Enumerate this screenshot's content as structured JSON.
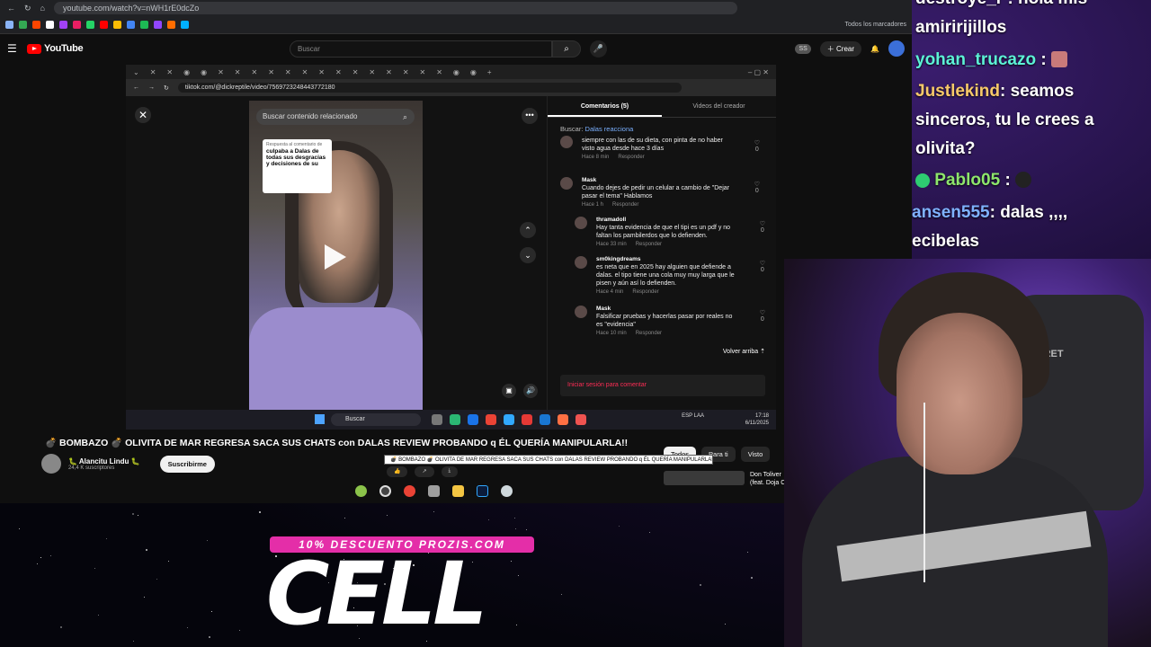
{
  "browser": {
    "url": "youtube.com/watch?v=nWH1rE0dcZo",
    "bookmarks_label": "Todos los marcadores"
  },
  "youtube": {
    "logo_text": "YouTube",
    "search_placeholder": "Buscar",
    "create_label": "Crear",
    "video_title": "💣 BOMBAZO 💣 OLIVITA DE MAR REGRESA SACA SUS CHATS con DALAS REVIEW PROBANDO q ÉL QUERÍA MANIPULARLA!!",
    "tooltip": "💣 BOMBAZO 💣 OLIVITA DE MAR REGRESA SACA SUS CHATS con DALAS REVIEW PROBANDO q ÉL QUERÍA MANIPULARLA!!",
    "channel_name": "🐛 Alancitu Lindu 🐛",
    "channel_subs": "24,4 K suscriptores",
    "subscribe_label": "Suscribirme",
    "chips": [
      "Todos",
      "Para ti",
      "Visto"
    ],
    "rec_title": "Don Toliver (feat. Doja C"
  },
  "tiktok": {
    "url": "tiktok.com/@dickreptile/video/7569723248443772180",
    "search_placeholder": "Buscar contenido relacionado",
    "reply_card_small": "Respuesta al comentario de",
    "reply_card_text": "culpaba a Dalas de todas sus desgracias y decisiones de su",
    "tab_comments": "Comentarios (5)",
    "tab_creator": "Videos del creador",
    "search_label": "Buscar:",
    "search_term": "Dalas reacciona",
    "comments": [
      {
        "user": "",
        "text": "siempre con las de su dieta, con pinta de no haber visto agua desde hace 3 días",
        "time": "Hace 8 min",
        "reply": "Responder",
        "likes": "0"
      },
      {
        "user": "Mask",
        "text": "Cuando dejes de pedir un celular a cambio de \"Dejar pasar el tema\" Hablamos",
        "time": "Hace 1 h",
        "reply": "Responder",
        "likes": "0"
      },
      {
        "user": "thramadoll",
        "text": "Hay tanta evidencia de que el tipi es un pdf y no faltan los pambilerdos que lo defienden.",
        "time": "Hace 33 min",
        "reply": "Responder",
        "likes": "0"
      },
      {
        "user": "sm0kingdreams",
        "text": "es neta que en 2025 hay alguien que defiende a dalas. el tipo tiene una cola muy muy larga que le pisen y aún así lo defienden.",
        "time": "Hace 4 min",
        "reply": "Responder",
        "likes": "0"
      },
      {
        "user": "Mask",
        "text": "Falsificar pruebas y hacerlas pasar por reales no es \"evidencia\"",
        "time": "Hace 10 min",
        "reply": "Responder",
        "likes": "0"
      }
    ],
    "back_top": "Volver arriba ⇡",
    "login_prompt": "Iniciar sesión para comentar"
  },
  "taskbar": {
    "search_label": "Buscar",
    "lang": "ESP\nLAA",
    "time": "17:18",
    "date": "6/11/2025"
  },
  "chat": [
    {
      "user": "destroye_r",
      "user_color": "#ffffff",
      "text": ": hola mis"
    },
    {
      "user": "",
      "user_color": "#ffffff",
      "text": "amiririjillos"
    },
    {
      "user": "yohan_trucazo",
      "user_color": "#5cf2d6",
      "text": ":"
    },
    {
      "user": "Justlekind",
      "user_color": "#f7c96a",
      "text": ": seamos"
    },
    {
      "user": "",
      "user_color": "#ffffff",
      "text": "sinceros, tu le crees a"
    },
    {
      "user": "",
      "user_color": "#ffffff",
      "text": "olivita?"
    },
    {
      "user": "Pablo05",
      "user_color": "#8ee66c",
      "text": ":"
    },
    {
      "user": "ansen555",
      "user_color": "#7fb2ff",
      "text": ": dalas ,,,,"
    },
    {
      "user": "",
      "user_color": "#ffffff",
      "text": "ecibelas"
    }
  ],
  "webcam": {
    "chair_text": "SECRET\nLAB"
  },
  "promo": {
    "badge": "10% DESCUENTO PROZIS.COM",
    "big": "CELL"
  }
}
